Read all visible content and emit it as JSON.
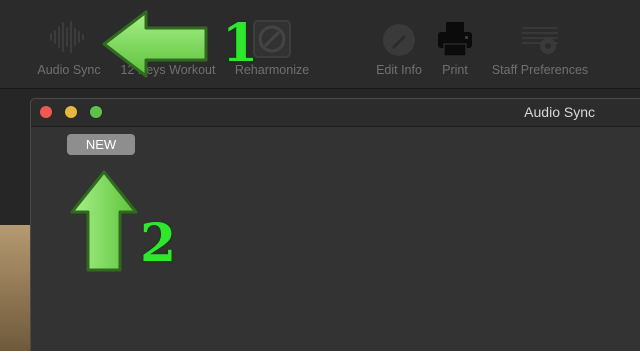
{
  "toolbar": {
    "items": [
      {
        "label": "Audio Sync",
        "icon": "waveform-icon"
      },
      {
        "label": "12 Keys Workout",
        "icon": "keys-workout-icon"
      },
      {
        "label": "Reharmonize",
        "icon": "reharmonize-icon"
      },
      {
        "label": "Edit Info",
        "icon": "edit-pencil-icon"
      },
      {
        "label": "Print",
        "icon": "printer-icon"
      },
      {
        "label": "Staff Preferences",
        "icon": "staff-gear-icon"
      }
    ]
  },
  "window": {
    "title": "Audio Sync",
    "new_button_label": "NEW",
    "traffic_lights": {
      "close": "#ee5a52",
      "minimize": "#e3b93e",
      "zoom": "#5fc04a"
    }
  },
  "callouts": {
    "step1": "1",
    "step2": "2",
    "color": "#2ee82e"
  }
}
